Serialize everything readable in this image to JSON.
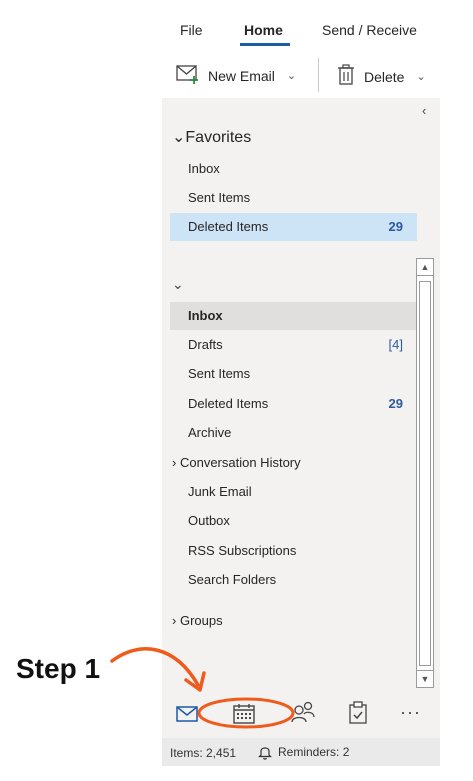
{
  "ribbon": {
    "tabs": [
      "File",
      "Home",
      "Send / Receive"
    ],
    "new_email_label": "New Email",
    "delete_label": "Delete"
  },
  "favorites": {
    "title": "Favorites",
    "items": [
      {
        "label": "Inbox",
        "count": ""
      },
      {
        "label": "Sent Items",
        "count": ""
      },
      {
        "label": "Deleted Items",
        "count": "29"
      }
    ]
  },
  "mailbox": {
    "items": [
      {
        "label": "Inbox",
        "count": ""
      },
      {
        "label": "Drafts",
        "count": "[4]"
      },
      {
        "label": "Sent Items",
        "count": ""
      },
      {
        "label": "Deleted Items",
        "count": "29"
      },
      {
        "label": "Archive",
        "count": ""
      },
      {
        "label": "Conversation History",
        "count": ""
      },
      {
        "label": "Junk Email",
        "count": ""
      },
      {
        "label": "Outbox",
        "count": ""
      },
      {
        "label": "RSS Subscriptions",
        "count": ""
      },
      {
        "label": "Search Folders",
        "count": ""
      }
    ],
    "groups_label": "Groups"
  },
  "status": {
    "items": "Items: 2,451",
    "reminders": "Reminders: 2"
  },
  "annotation": {
    "step_label": "Step 1",
    "color": "#f05a1a"
  },
  "colors": {
    "accent": "#1b5ba8",
    "selected": "#cde3f6",
    "count": "#2b5aa0"
  }
}
